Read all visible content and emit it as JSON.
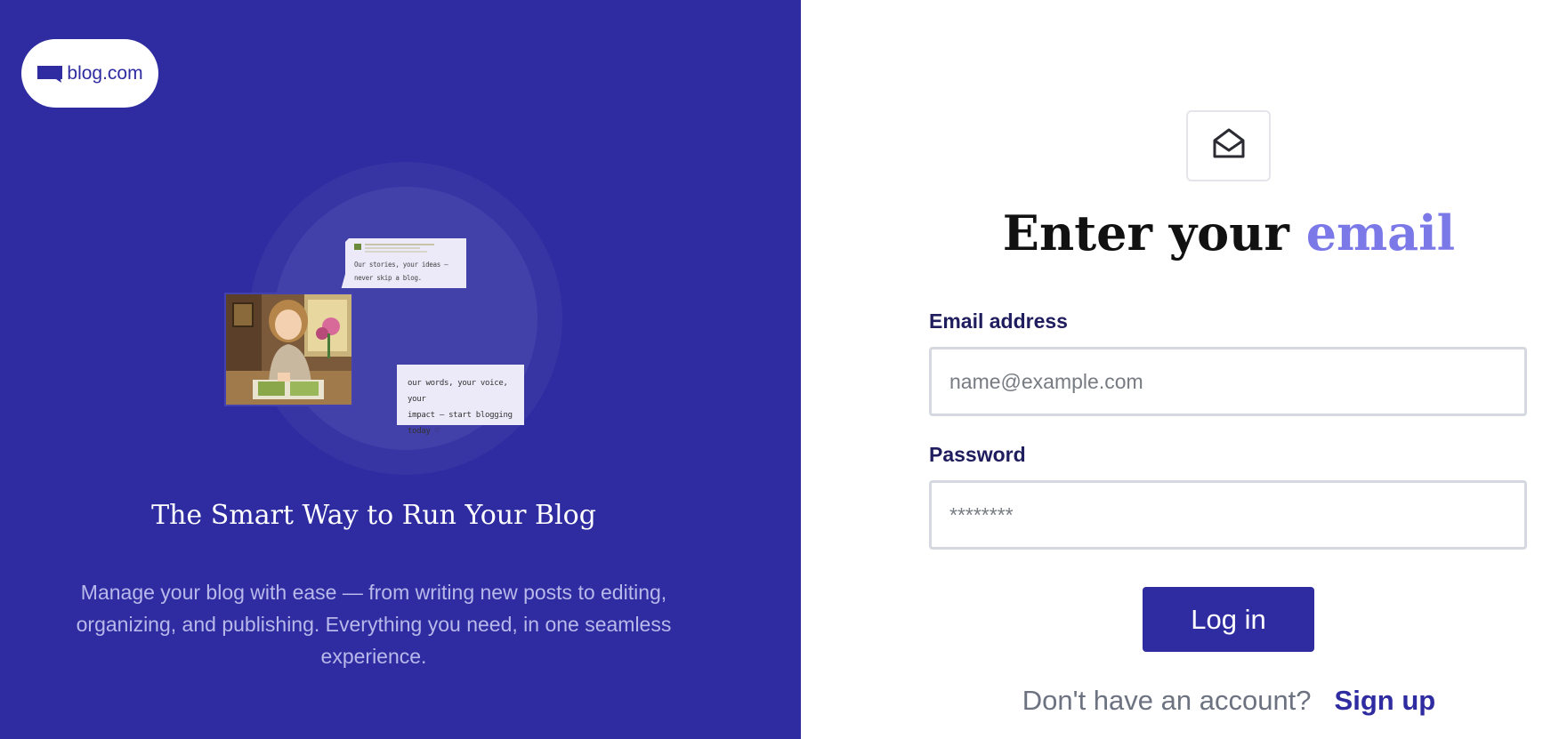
{
  "brand": {
    "name": "blog.com"
  },
  "hero": {
    "tagline": "The Smart Way to Run Your Blog",
    "description": "Manage your blog with ease — from writing new posts to editing, organizing, and publishing. Everything you need, in one seamless experience.",
    "bubble_note": "Our stories, your ideas – never skip a blog.",
    "card_note_line1": "our words, your voice, your",
    "card_note_line2": "impact – start blogging today ♡"
  },
  "login": {
    "icon": "envelope-open-icon",
    "heading_prefix": "Enter your",
    "heading_accent": "email",
    "email_label": "Email address",
    "email_placeholder": "name@example.com",
    "password_label": "Password",
    "password_placeholder": "********",
    "submit_label": "Log in",
    "signup_prompt": "Don't have an account?",
    "signup_link": "Sign up"
  },
  "colors": {
    "brand": "#2e2ca0",
    "accent": "#7b78e8",
    "field_border": "#d5d9df"
  }
}
